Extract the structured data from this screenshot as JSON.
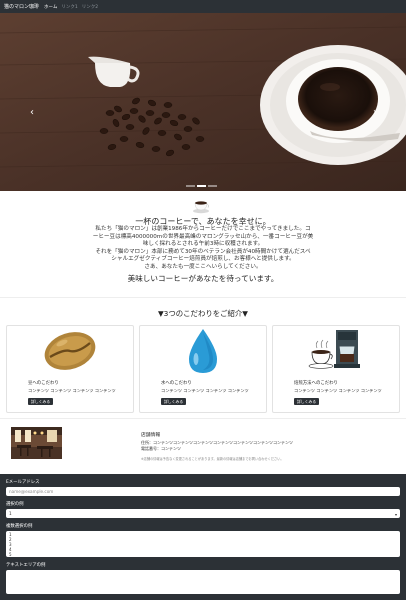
{
  "navbar": {
    "brand": "猫のマロン珈琲",
    "links": [
      {
        "label": "ホーム",
        "active": true
      },
      {
        "label": "リンク1",
        "active": false
      },
      {
        "label": "リンク2",
        "active": false
      }
    ]
  },
  "carousel": {
    "prev_glyph": "‹",
    "next_glyph": "›",
    "slide_count": 3,
    "active_slide": 1
  },
  "intro": {
    "title": "一杯のコーヒーで、あなたを幸せに。",
    "lines": [
      "私たち「猫のマロン」は創業1986年からコーヒーだけでここまでやってきました。コ",
      "ーヒー豆は標高4000000mの世界最高峰のマロングラッセ山から、一番コーヒー豆が美",
      "味しく採れるとされる午前3時に収穫されます。",
      "それを「猫のマロン」本部に務めて30年のベテラン会社員が40時間かけて選んだスペ",
      "シャルエグゼクティブコーヒー焙煎員が焙煎し、お客様へと提供します。",
      "さあ、あなたも一度ここへいらしてください。"
    ],
    "tagline": "美味しいコーヒーがあなたを待っています。"
  },
  "features": {
    "title": "▼3つのこだわりをご紹介▼",
    "cards": [
      {
        "title": "豆へのこだわり",
        "text": "コンテンツ コンテンツ コンテンツ コンテンツ",
        "button": "詳しくみる",
        "icon": "coffee-bean-icon"
      },
      {
        "title": "水へのこだわり",
        "text": "コンテンツ コンテンツ コンテンツ コンテンツ",
        "button": "詳しくみる",
        "icon": "water-drop-icon"
      },
      {
        "title": "焙煎方法へのこだわり",
        "text": "コンテンツ コンテンツ コンテンツ コンテンツ",
        "button": "詳しくみる",
        "icon": "coffee-maker-icon"
      }
    ]
  },
  "shop": {
    "title": "店舗情報",
    "address": "住所：コンテンツコンテンツコンテンツコンテンツコンテンツコンテンツコンテンツ",
    "phone": "電話番号：コンテンツ",
    "note": "※店舗の情報は予告なく変更されることがあります。最新の情報は店舗までお問い合わせください。"
  },
  "form": {
    "email_label": "Eメールアドレス",
    "email_placeholder": "name@example.com",
    "select_label": "選択の例",
    "select_value": "1",
    "multi_label": "複数選択の例",
    "multi_options": [
      "1",
      "2",
      "3",
      "4",
      "5"
    ],
    "textarea_label": "テキストエリアの例"
  },
  "colors": {
    "navbar_bg": "#2c3136",
    "button_bg": "#2c3136",
    "page_bg": "#ffffff"
  }
}
